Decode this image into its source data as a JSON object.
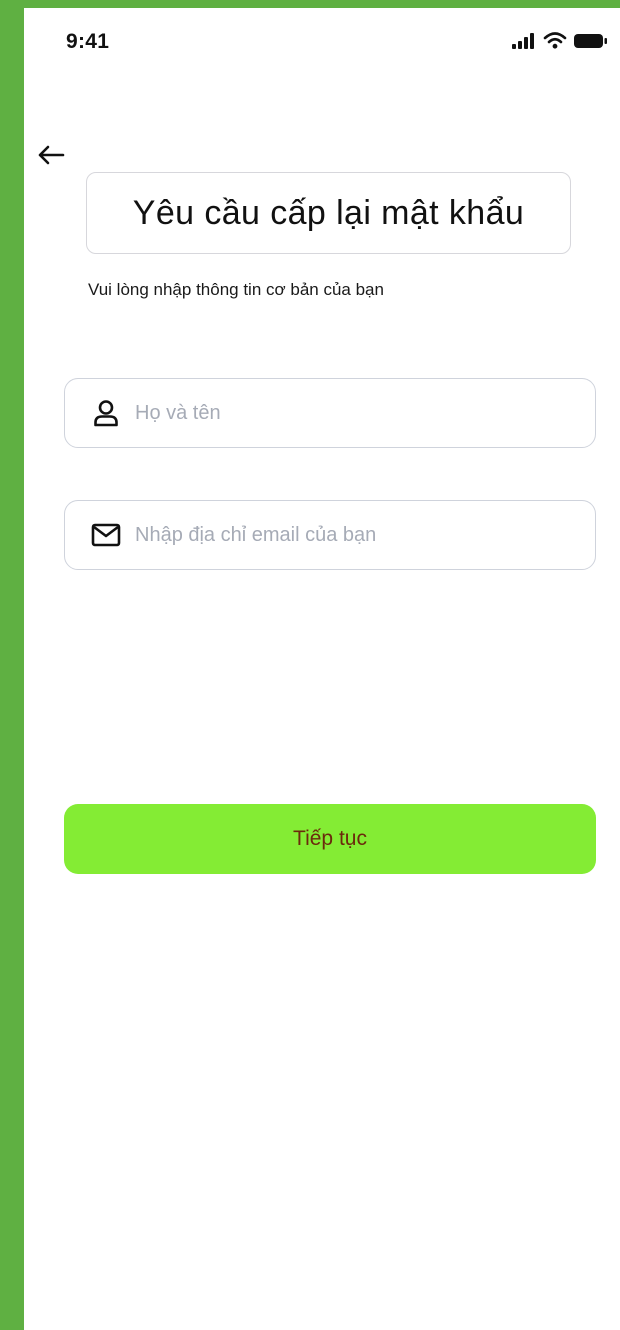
{
  "status_bar": {
    "time": "9:41",
    "icons": [
      "cellular-signal-icon",
      "wifi-icon",
      "battery-icon"
    ]
  },
  "nav": {
    "back_icon": "arrow-left-icon"
  },
  "header": {
    "title": "Yêu cầu cấp lại mật khẩu",
    "subtitle": "Vui lòng nhập thông tin cơ bản của bạn"
  },
  "form": {
    "name_field": {
      "icon": "user-icon",
      "value": "",
      "placeholder": "Họ và tên"
    },
    "email_field": {
      "icon": "mail-icon",
      "value": "",
      "placeholder": "Nhập địa chỉ email của bạn"
    },
    "submit_label": "Tiếp tục"
  },
  "colors": {
    "frame_background": "#5fb042",
    "screen_background": "#ffffff",
    "button_background": "#84ec34",
    "button_text": "#6b2a0c",
    "placeholder_text": "#a6abb6",
    "field_border": "#cfd3dc"
  }
}
